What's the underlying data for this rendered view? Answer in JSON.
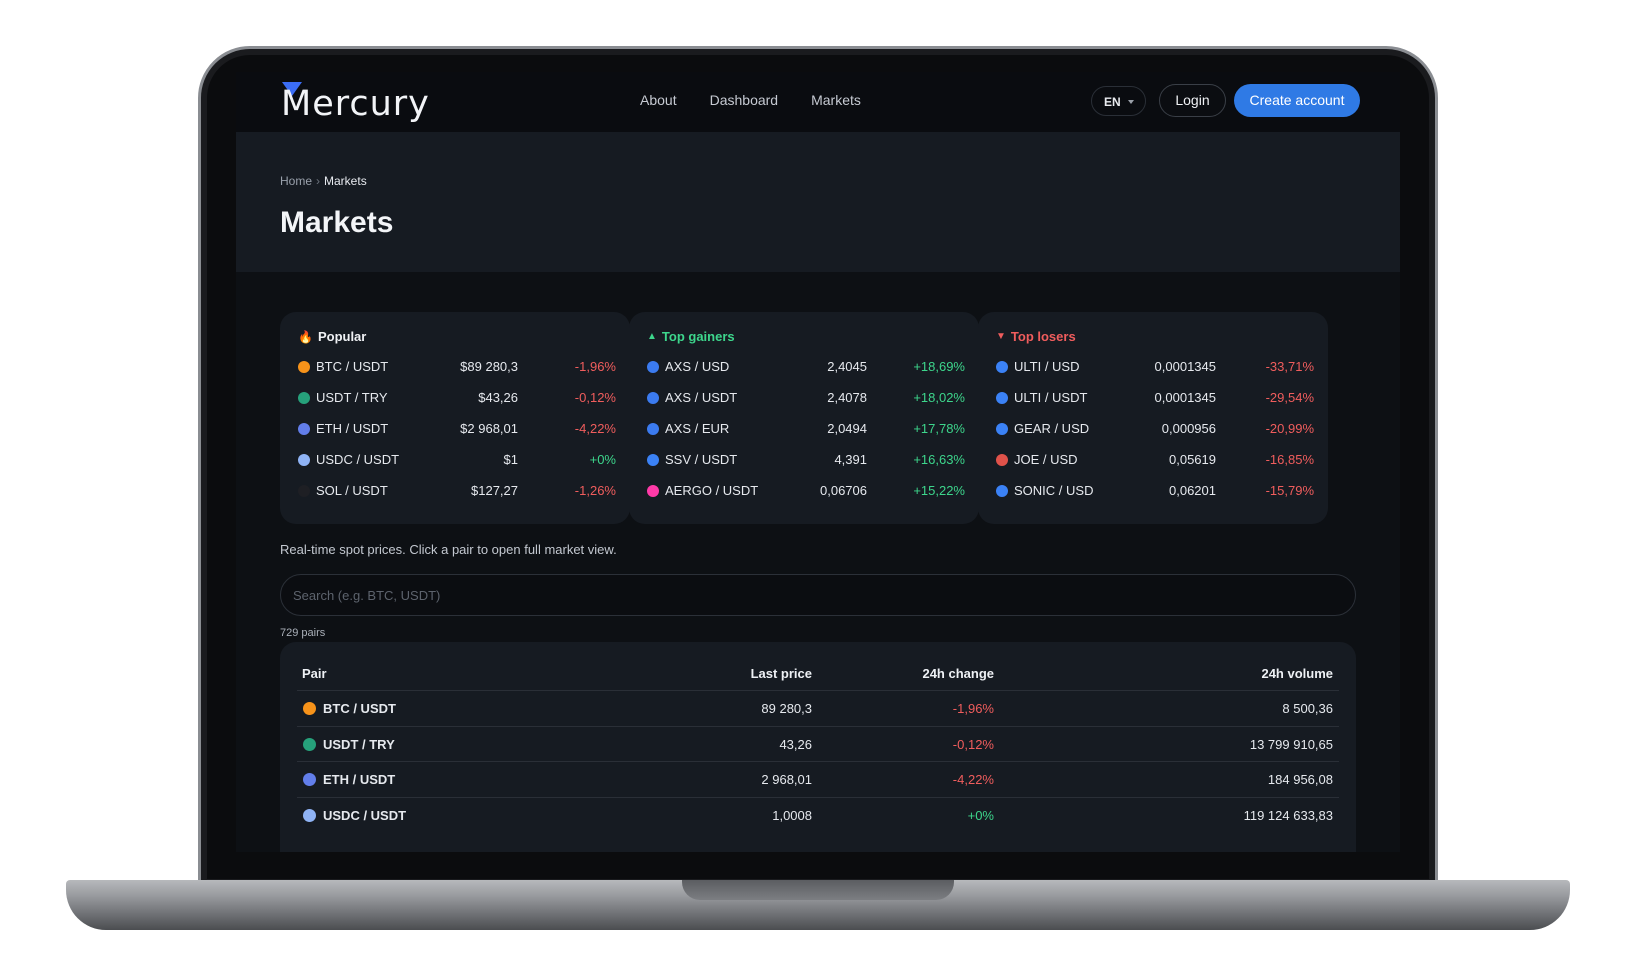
{
  "nav": {
    "logo": "Mercury",
    "links": [
      "About",
      "Dashboard",
      "Markets"
    ],
    "lang": "EN",
    "login": "Login",
    "create_account": "Create account"
  },
  "hero": {
    "breadcrumb": [
      "Home",
      "Markets"
    ],
    "title": "Markets"
  },
  "cards": [
    {
      "title": "Popular",
      "title_icon": "fire-icon",
      "title_color": "#f0f2f5",
      "rows": [
        {
          "icon": "btc-icon",
          "color": "#f7931a",
          "pair": "BTC / USDT",
          "price": "$89 280,3",
          "change": "-1,96%",
          "dir": "neg"
        },
        {
          "icon": "usdt-icon",
          "color": "#26a17b",
          "pair": "USDT / TRY",
          "price": "$43,26",
          "change": "-0,12%",
          "dir": "neg"
        },
        {
          "icon": "eth-icon",
          "color": "#627eea",
          "pair": "ETH / USDT",
          "price": "$2 968,01",
          "change": "-4,22%",
          "dir": "neg"
        },
        {
          "icon": "usdc-icon",
          "color": "#8fb3f5",
          "pair": "USDC / USDT",
          "price": "$1",
          "change": "+0%",
          "dir": "pos"
        },
        {
          "icon": "sol-icon",
          "color": "#1e1f24",
          "pair": "SOL / USDT",
          "price": "$127,27",
          "change": "-1,26%",
          "dir": "neg"
        }
      ]
    },
    {
      "title": "Top gainers",
      "title_icon": "triangle-up-icon",
      "title_color": "#3dd68c",
      "rows": [
        {
          "icon": "axs-icon",
          "color": "#3b7bf0",
          "pair": "AXS / USD",
          "price": "2,4045",
          "change": "+18,69%",
          "dir": "pos"
        },
        {
          "icon": "axs-icon",
          "color": "#3b7bf0",
          "pair": "AXS / USDT",
          "price": "2,4078",
          "change": "+18,02%",
          "dir": "pos"
        },
        {
          "icon": "axs-icon",
          "color": "#3b7bf0",
          "pair": "AXS / EUR",
          "price": "2,0494",
          "change": "+17,78%",
          "dir": "pos"
        },
        {
          "icon": "ssv-icon",
          "color": "#3b82f6",
          "pair": "SSV / USDT",
          "price": "4,391",
          "change": "+16,63%",
          "dir": "pos"
        },
        {
          "icon": "aergo-icon",
          "color": "#ff3aa8",
          "pair": "AERGO / USDT",
          "price": "0,06706",
          "change": "+15,22%",
          "dir": "pos"
        }
      ]
    },
    {
      "title": "Top losers",
      "title_icon": "triangle-down-icon",
      "title_color": "#f05d5d",
      "rows": [
        {
          "icon": "ulti-icon",
          "color": "#3b82f6",
          "pair": "ULTI / USD",
          "price": "0,0001345",
          "change": "-33,71%",
          "dir": "neg"
        },
        {
          "icon": "ulti-icon",
          "color": "#3b82f6",
          "pair": "ULTI / USDT",
          "price": "0,0001345",
          "change": "-29,54%",
          "dir": "neg"
        },
        {
          "icon": "gear-icon",
          "color": "#3b82f6",
          "pair": "GEAR / USD",
          "price": "0,000956",
          "change": "-20,99%",
          "dir": "neg"
        },
        {
          "icon": "joe-icon",
          "color": "#e0524a",
          "pair": "JOE / USD",
          "price": "0,05619",
          "change": "-16,85%",
          "dir": "neg"
        },
        {
          "icon": "sonic-icon",
          "color": "#3b82f6",
          "pair": "SONIC / USD",
          "price": "0,06201",
          "change": "-15,79%",
          "dir": "neg"
        }
      ]
    }
  ],
  "note": "Real-time spot prices. Click a pair to open full market view.",
  "search": {
    "placeholder": "Search (e.g. BTC, USDT)"
  },
  "pairs_count": "729 pairs",
  "table": {
    "headers": {
      "pair": "Pair",
      "last": "Last price",
      "change": "24h change",
      "volume": "24h volume"
    },
    "rows": [
      {
        "icon": "btc-icon",
        "color": "#f7931a",
        "pair": "BTC / USDT",
        "last": "89 280,3",
        "change": "-1,96%",
        "dir": "neg",
        "volume": "8 500,36"
      },
      {
        "icon": "usdt-icon",
        "color": "#26a17b",
        "pair": "USDT / TRY",
        "last": "43,26",
        "change": "-0,12%",
        "dir": "neg",
        "volume": "13 799 910,65"
      },
      {
        "icon": "eth-icon",
        "color": "#627eea",
        "pair": "ETH / USDT",
        "last": "2 968,01",
        "change": "-4,22%",
        "dir": "neg",
        "volume": "184 956,08"
      },
      {
        "icon": "usdc-icon",
        "color": "#8fb3f5",
        "pair": "USDC / USDT",
        "last": "1,0008",
        "change": "+0%",
        "dir": "pos",
        "volume": "119 124 633,83"
      }
    ]
  },
  "colors": {
    "accent": "#2f7ae5",
    "positive": "#3dd68c",
    "negative": "#f05d5d"
  }
}
